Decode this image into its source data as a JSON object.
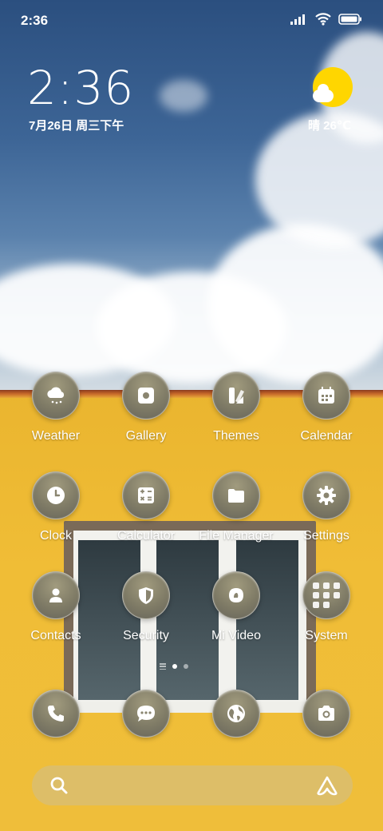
{
  "status_bar": {
    "time": "2:36",
    "icons": [
      "signal-icon",
      "wifi-icon",
      "battery-icon"
    ]
  },
  "clock_widget": {
    "time": "2:36",
    "date": "7月26日 周三下午"
  },
  "weather_widget": {
    "text": "晴 26℃",
    "icon": "sunny-partly-cloudy-icon"
  },
  "apps": [
    {
      "label": "Weather",
      "icon": "weather-icon"
    },
    {
      "label": "Gallery",
      "icon": "gallery-icon"
    },
    {
      "label": "Themes",
      "icon": "themes-icon"
    },
    {
      "label": "Calendar",
      "icon": "calendar-icon"
    },
    {
      "label": "Clock",
      "icon": "clock-icon"
    },
    {
      "label": "Calculator",
      "icon": "calculator-icon"
    },
    {
      "label": "File Manager",
      "icon": "folder-icon"
    },
    {
      "label": "Settings",
      "icon": "gear-icon"
    },
    {
      "label": "Contacts",
      "icon": "contacts-icon"
    },
    {
      "label": "Security",
      "icon": "shield-icon"
    },
    {
      "label": "Mi Video",
      "icon": "video-icon"
    },
    {
      "label": "System",
      "icon": "folder-grid-icon"
    }
  ],
  "page_indicator": {
    "pages": 2,
    "current": 1
  },
  "dock": [
    {
      "icon": "phone-icon"
    },
    {
      "icon": "messages-icon"
    },
    {
      "icon": "browser-icon"
    },
    {
      "icon": "camera-icon"
    }
  ],
  "search_bar": {
    "left_icon": "search-icon",
    "right_icon": "assistant-icon"
  }
}
